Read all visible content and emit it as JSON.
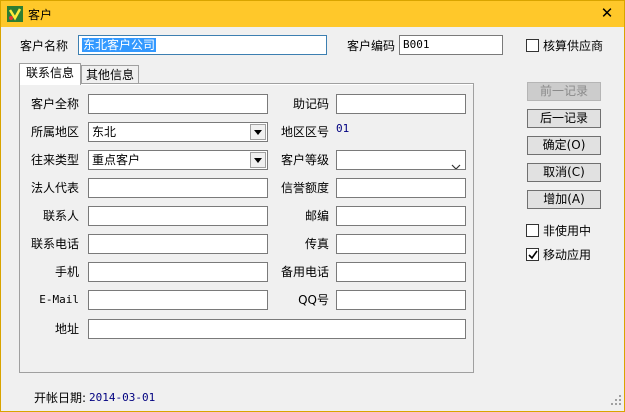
{
  "window": {
    "title": "客户",
    "close_glyph": "✕",
    "icon": "app-icon"
  },
  "header": {
    "name_label": "客户名称",
    "name_value": "东北客户公司",
    "code_label": "客户编码",
    "code_value": "B001",
    "supplier_checkbox_label": "核算供应商",
    "supplier_checked": false
  },
  "tabs": [
    {
      "label": "联系信息",
      "active": true
    },
    {
      "label": "其他信息",
      "active": false
    }
  ],
  "form": {
    "full_name_label": "客户全称",
    "full_name_value": "",
    "mnemonic_label": "助记码",
    "mnemonic_value": "",
    "region_label": "所属地区",
    "region_value": "东北",
    "region_code_label": "地区区号",
    "region_code_value": "01",
    "type_label": "往来类型",
    "type_value": "重点客户",
    "level_label": "客户等级",
    "level_value": "",
    "legal_label": "法人代表",
    "legal_value": "",
    "credit_label": "信誉额度",
    "credit_value": "",
    "contact_label": "联系人",
    "contact_value": "",
    "zip_label": "邮编",
    "zip_value": "",
    "phone_label": "联系电话",
    "phone_value": "",
    "fax_label": "传真",
    "fax_value": "",
    "mobile_label": "手机",
    "mobile_value": "",
    "alt_phone_label": "备用电话",
    "alt_phone_value": "",
    "email_label": "E-Mail",
    "email_value": "",
    "qq_label": "QQ号",
    "qq_value": "",
    "address_label": "地址",
    "address_value": ""
  },
  "buttons": {
    "prev": "前一记录",
    "next": "后一记录",
    "ok": "确定(O)",
    "cancel": "取消(C)",
    "add": "增加(A)"
  },
  "options": {
    "inactive_label": "非使用中",
    "inactive_checked": false,
    "mobile_app_label": "移动应用",
    "mobile_app_checked": true
  },
  "footer": {
    "open_date_label": "开帐日期:",
    "open_date_value": "2014-03-01"
  },
  "colors": {
    "titlebar": "#ffc82a",
    "selection": "#3399ff",
    "value_text": "#000080"
  }
}
